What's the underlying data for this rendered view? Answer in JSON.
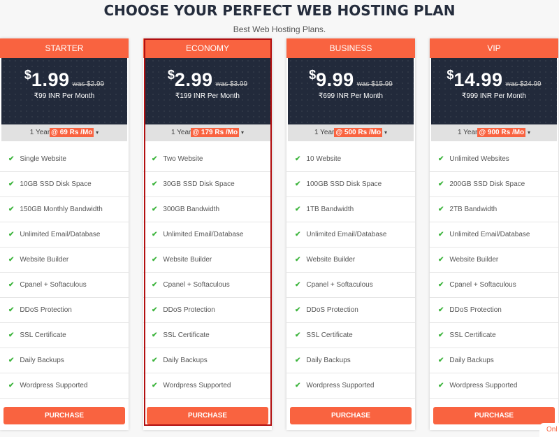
{
  "header": {
    "title": "CHOOSE YOUR PERFECT WEB HOSTING PLAN",
    "subtitle": "Best Web Hosting Plans."
  },
  "colors": {
    "accent": "#f96340",
    "dark_panel": "#222a3b",
    "check": "#3cb43c",
    "selection_outline": "#b20f10"
  },
  "plans": [
    {
      "name": "STARTER",
      "currency": "$",
      "price": "1.99",
      "was": "was $2.99",
      "inr": "₹99 INR Per Month",
      "duration": "1 Year",
      "rate": "@ 69 Rs /Mo",
      "features": [
        "Single Website",
        "10GB SSD Disk Space",
        "150GB Monthly Bandwidth",
        "Unlimited Email/Database",
        "Website Builder",
        "Cpanel + Softaculous",
        "DDoS Protection",
        "SSL Certificate",
        "Daily Backups",
        "Wordpress Supported"
      ],
      "button": "PURCHASE"
    },
    {
      "name": "ECONOMY",
      "currency": "$",
      "price": "2.99",
      "was": "was $3.99",
      "inr": "₹199 INR Per Month",
      "duration": "1 Year",
      "rate": "@ 179 Rs /Mo",
      "features": [
        "Two Website",
        "30GB SSD Disk Space",
        "300GB Bandwidth",
        "Unlimited Email/Database",
        "Website Builder",
        "Cpanel + Softaculous",
        "DDoS Protection",
        "SSL Certificate",
        "Daily Backups",
        "Wordpress Supported"
      ],
      "button": "PURCHASE",
      "selected": true
    },
    {
      "name": "BUSINESS",
      "currency": "$",
      "price": "9.99",
      "was": "was $15.99",
      "inr": "₹699 INR Per Month",
      "duration": "1 Year",
      "rate": "@ 500 Rs /Mo",
      "features": [
        "10 Website",
        "100GB SSD Disk Space",
        "1TB Bandwidth",
        "Unlimited Email/Database",
        "Website Builder",
        "Cpanel + Softaculous",
        "DDoS Protection",
        "SSL Certificate",
        "Daily Backups",
        "Wordpress Supported"
      ],
      "button": "PURCHASE"
    },
    {
      "name": "VIP",
      "currency": "$",
      "price": "14.99",
      "was": "was $24.99",
      "inr": "₹999 INR Per Month",
      "duration": "1 Year",
      "rate": "@ 900 Rs /Mo",
      "features": [
        "Unlimited Websites",
        "200GB SSD Disk Space",
        "2TB Bandwidth",
        "Unlimited Email/Database",
        "Website Builder",
        "Cpanel + Softaculous",
        "DDoS Protection",
        "SSL Certificate",
        "Daily Backups",
        "Wordpress Supported"
      ],
      "button": "PURCHASE"
    }
  ],
  "icons": {
    "check": "✔",
    "caret": "▾"
  },
  "online_badge": "Onl"
}
